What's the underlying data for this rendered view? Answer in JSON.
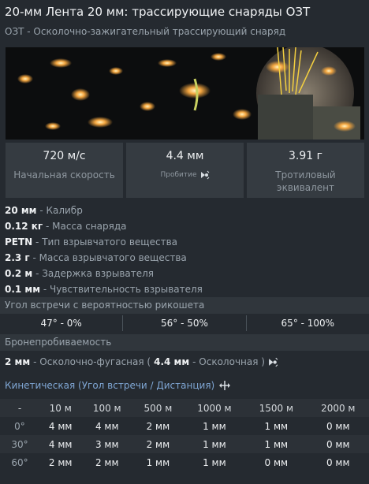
{
  "header": {
    "title": "20-мм Лента 20 мм: трассирующие снаряды ОЗТ",
    "subtitle": "ОЗТ - Осколочно-зажигательный трассирующий снаряд"
  },
  "stats": [
    {
      "value": "720 м/с",
      "label": "Начальная скорость"
    },
    {
      "value": "4.4 мм",
      "label": "Пробитие"
    },
    {
      "value": "3.91 г",
      "label": "Тротиловый эквивалент"
    }
  ],
  "properties": [
    {
      "value": "20 мм",
      "desc": " - Калибр"
    },
    {
      "value": "0.12 кг",
      "desc": " - Масса снаряда"
    },
    {
      "value": "PETN",
      "desc": " - Тип взрывчатого вещества"
    },
    {
      "value": "2.3 г",
      "desc": " - Масса взрывчатого вещества"
    },
    {
      "value": "0.2 м",
      "desc": " - Задержка взрывателя"
    },
    {
      "value": "0.1 мм",
      "desc": " - Чувствительность взрывателя"
    }
  ],
  "ricochet": {
    "title": "Угол встречи с вероятностью рикошета",
    "values": [
      "47° - 0%",
      "56° - 50%",
      "65° - 100%"
    ]
  },
  "penetration": {
    "title": "Бронепробиваемость",
    "he_value": "2 мм",
    "he_label": " - Осколочно-фугасная (",
    "frag_value": "4.4 мм",
    "frag_label": " - Осколочная )",
    "kinetic_title": "Кинетическая (Угол встречи / Дистанция)"
  },
  "table": {
    "columns": [
      "-",
      "10 м",
      "100 м",
      "500 м",
      "1000 м",
      "1500 м",
      "2000 м"
    ],
    "rows": [
      {
        "angle": "0°",
        "values": [
          "4 мм",
          "4 мм",
          "2 мм",
          "1 мм",
          "1 мм",
          "0 мм"
        ]
      },
      {
        "angle": "30°",
        "values": [
          "4 мм",
          "3 мм",
          "2 мм",
          "1 мм",
          "1 мм",
          "0 мм"
        ]
      },
      {
        "angle": "60°",
        "values": [
          "2 мм",
          "2 мм",
          "1 мм",
          "1 мм",
          "0 мм",
          "0 мм"
        ]
      }
    ]
  },
  "colors": {
    "background": "#252a30",
    "accent_link": "#7fa6d4",
    "spark": "#f4a640"
  },
  "icons": [
    "penetration-icon",
    "distance-icon"
  ]
}
